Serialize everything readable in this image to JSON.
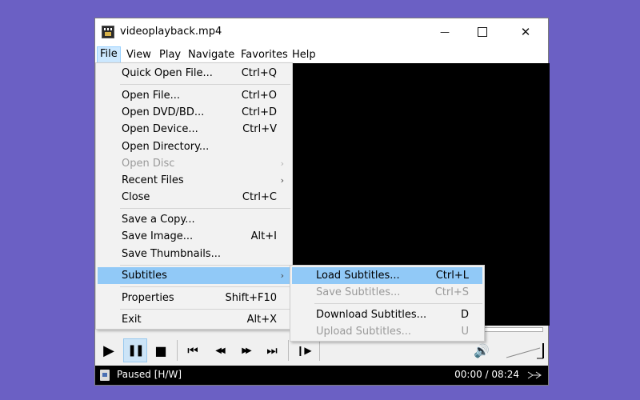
{
  "window": {
    "title": "videoplayback.mp4"
  },
  "menubar": [
    "File",
    "View",
    "Play",
    "Navigate",
    "Favorites",
    "Help"
  ],
  "file_menu": [
    {
      "label": "Quick Open File...",
      "accel": "Ctrl+Q"
    },
    {
      "label": "Open File...",
      "accel": "Ctrl+O"
    },
    {
      "label": "Open DVD/BD...",
      "accel": "Ctrl+D"
    },
    {
      "label": "Open Device...",
      "accel": "Ctrl+V"
    },
    {
      "label": "Open Directory...",
      "accel": ""
    },
    {
      "label": "Open Disc",
      "accel": ""
    },
    {
      "label": "Recent Files",
      "accel": ""
    },
    {
      "label": "Close",
      "accel": "Ctrl+C"
    },
    {
      "label": "Save a Copy...",
      "accel": ""
    },
    {
      "label": "Save Image...",
      "accel": "Alt+I"
    },
    {
      "label": "Save Thumbnails...",
      "accel": ""
    },
    {
      "label": "Subtitles",
      "accel": ""
    },
    {
      "label": "Properties",
      "accel": "Shift+F10"
    },
    {
      "label": "Exit",
      "accel": "Alt+X"
    }
  ],
  "subtitles_menu": [
    {
      "label": "Load Subtitles...",
      "accel": "Ctrl+L"
    },
    {
      "label": "Save Subtitles...",
      "accel": "Ctrl+S"
    },
    {
      "label": "Download Subtitles...",
      "accel": "D"
    },
    {
      "label": "Upload Subtitles...",
      "accel": "U"
    }
  ],
  "status": {
    "text": "Paused [H/W]",
    "time": "00:00 / 08:24"
  },
  "icons": {
    "close": "✕",
    "minimize": "—",
    "arrow": "›",
    "play": "▶",
    "pause": "❚❚",
    "stop": "■",
    "prev": "⏮",
    "rewind": "◀◀",
    "forward": "▶▶",
    "next": "⏭",
    "frame_step": "❙▶",
    "volume": "🔊"
  },
  "colors": {
    "background": "#6b60c4",
    "highlight": "#91c9f7",
    "active_menu": "#cce8ff"
  }
}
